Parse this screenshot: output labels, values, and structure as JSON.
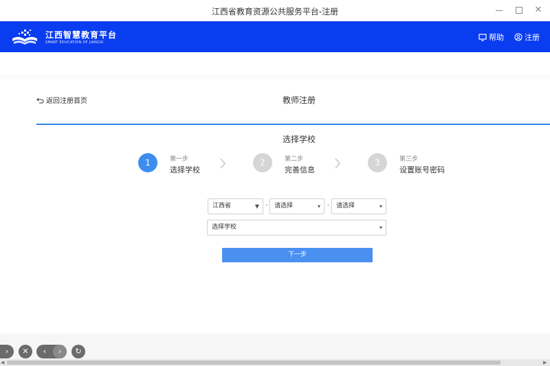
{
  "window": {
    "title": "江西省教育资源公共服务平台-注册",
    "minimize_icon": "minimize-icon",
    "maximize_icon": "maximize-icon",
    "close_icon": "close-icon"
  },
  "header": {
    "brand_cn": "江西智慧教育平台",
    "brand_en": "SMART EDUCATION OF JIANGXI",
    "help_label": "帮助",
    "help_icon": "monitor-icon",
    "register_label": "注册",
    "register_icon": "user-icon",
    "background_color": "#0a3cf0"
  },
  "page": {
    "back_label": "返回注册首页",
    "heading": "教师注册",
    "section_title": "选择学校",
    "accent_color": "#2f86e8"
  },
  "steps": [
    {
      "number": "1",
      "sub": "第一步",
      "name": "选择学校",
      "active": true
    },
    {
      "number": "2",
      "sub": "第二步",
      "name": "完善信息",
      "active": false
    },
    {
      "number": "3",
      "sub": "第三步",
      "name": "设置账号密码",
      "active": false
    }
  ],
  "form": {
    "province": "江西省",
    "city": "请选择",
    "district": "请选择",
    "separator": "-",
    "school": "选择学校",
    "next_label": "下一步"
  },
  "bottom_nav": {
    "icons": [
      "expand-icon",
      "close-icon",
      "back-icon",
      "forward-icon",
      "refresh-icon"
    ]
  }
}
